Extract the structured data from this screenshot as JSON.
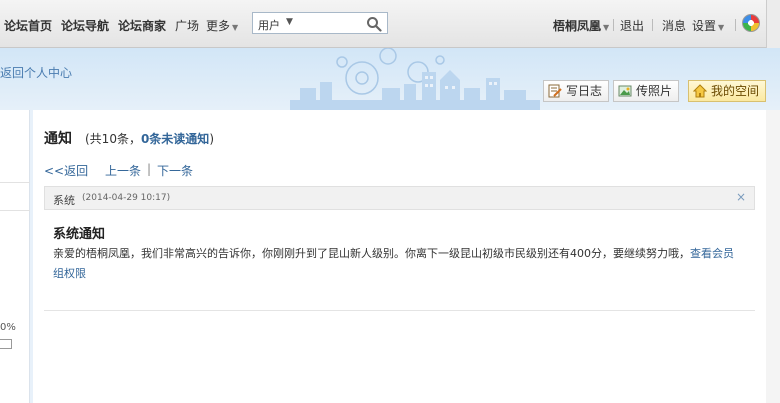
{
  "nav": {
    "home": "论坛首页",
    "guide": "论坛导航",
    "merchants": "论坛商家",
    "square": "广场",
    "more": "更多",
    "search_type": "用户",
    "username": "梧桐凤凰",
    "logout": "退出",
    "messages": "消息",
    "settings": "设置"
  },
  "banner": {
    "back_to_personal": "返回个人中心",
    "write_blog": "写日志",
    "upload_photo": "传照片",
    "my_space": "我的空间"
  },
  "left": {
    "percent": "0%"
  },
  "page": {
    "title": "通知",
    "count_prefix": "(共10条，",
    "unread": "0条未读通知",
    "count_suffix": ")",
    "back": "<<返回",
    "prev": "上一条",
    "separator": "|",
    "next": "下一条"
  },
  "notice": {
    "category": "系统",
    "time": "(2014-04-29 10:17)",
    "close": "×",
    "title": "系统通知",
    "body_line1": "亲爱的梧桐凤凰，我们非常高兴的告诉你，你刚刚升到了昆山新人级别。你离下一级昆山初级市民级别还有400分，要继续努力哦，",
    "body_link1": "查看会员",
    "body_link2": "组权限"
  }
}
